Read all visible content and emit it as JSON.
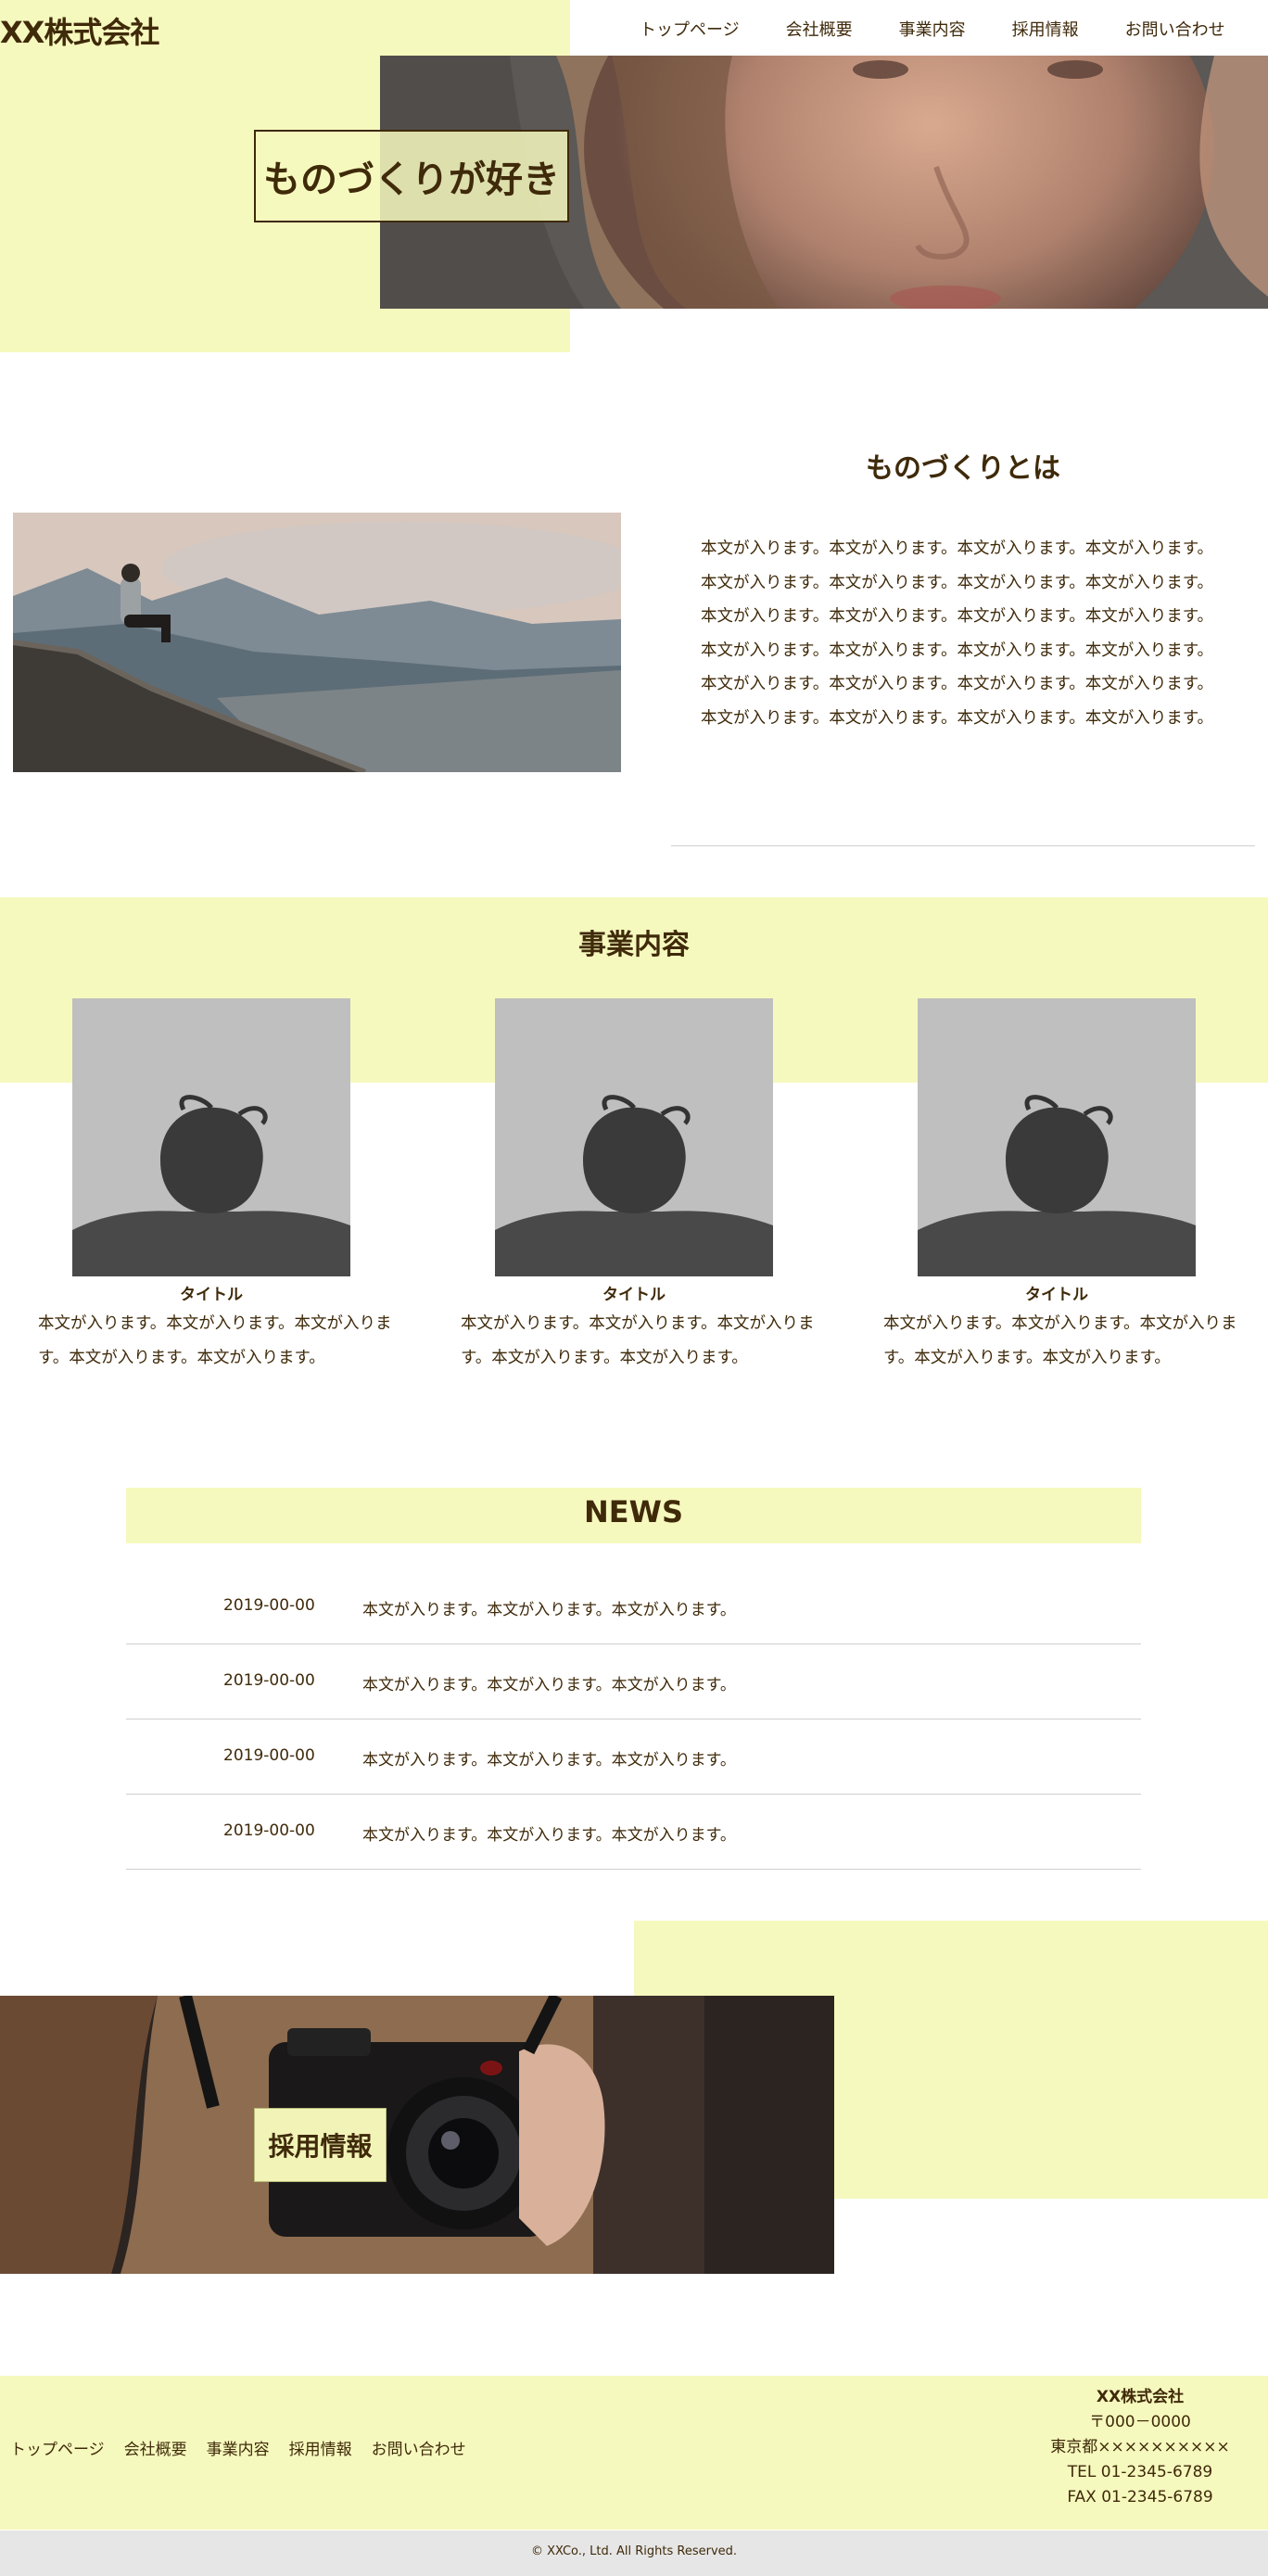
{
  "header": {
    "logo": "XX株式会社",
    "nav": [
      "トップページ",
      "会社概要",
      "事業内容",
      "採用情報",
      "お問い合わせ"
    ]
  },
  "hero": {
    "title": "ものづくりが好き"
  },
  "about": {
    "heading": "ものづくりとは",
    "body": "本文が入ります。本文が入ります。本文が入ります。本文が入ります。本文が入ります。本文が入ります。本文が入ります。本文が入ります。本文が入ります。本文が入ります。本文が入ります。本文が入ります。本文が入ります。本文が入ります。本文が入ります。本文が入ります。本文が入ります。本文が入ります。本文が入ります。本文が入ります。本文が入ります。本文が入ります。本文が入ります。本文が入ります。"
  },
  "business": {
    "heading": "事業内容",
    "cards": [
      {
        "title": "タイトル",
        "text": "本文が入ります。本文が入ります。本文が入ります。本文が入ります。本文が入ります。"
      },
      {
        "title": "タイトル",
        "text": "本文が入ります。本文が入ります。本文が入ります。本文が入ります。本文が入ります。"
      },
      {
        "title": "タイトル",
        "text": "本文が入ります。本文が入ります。本文が入ります。本文が入ります。本文が入ります。"
      }
    ]
  },
  "news": {
    "heading": "NEWS",
    "items": [
      {
        "date": "2019-00-00",
        "text": "本文が入ります。本文が入ります。本文が入ります。"
      },
      {
        "date": "2019-00-00",
        "text": "本文が入ります。本文が入ります。本文が入ります。"
      },
      {
        "date": "2019-00-00",
        "text": "本文が入ります。本文が入ります。本文が入ります。"
      },
      {
        "date": "2019-00-00",
        "text": "本文が入ります。本文が入ります。本文が入ります。"
      }
    ]
  },
  "recruit": {
    "title": "採用情報"
  },
  "footer": {
    "nav": [
      "トップページ",
      "会社概要",
      "事業内容",
      "採用情報",
      "お問い合わせ"
    ],
    "company": "XX株式会社",
    "postal": "〒000－0000",
    "address": "東京都××××××××××",
    "tel": "TEL 01-2345-6789",
    "fax": "FAX 01-2345-6789",
    "copyright": "© XXCo., Ltd. All Rights Reserved."
  },
  "colors": {
    "accent_yellow": "#f6f9be",
    "text_brown": "#3f2a0a",
    "divider": "#cfcfcf",
    "copyright_bg": "#e6e6e6"
  }
}
